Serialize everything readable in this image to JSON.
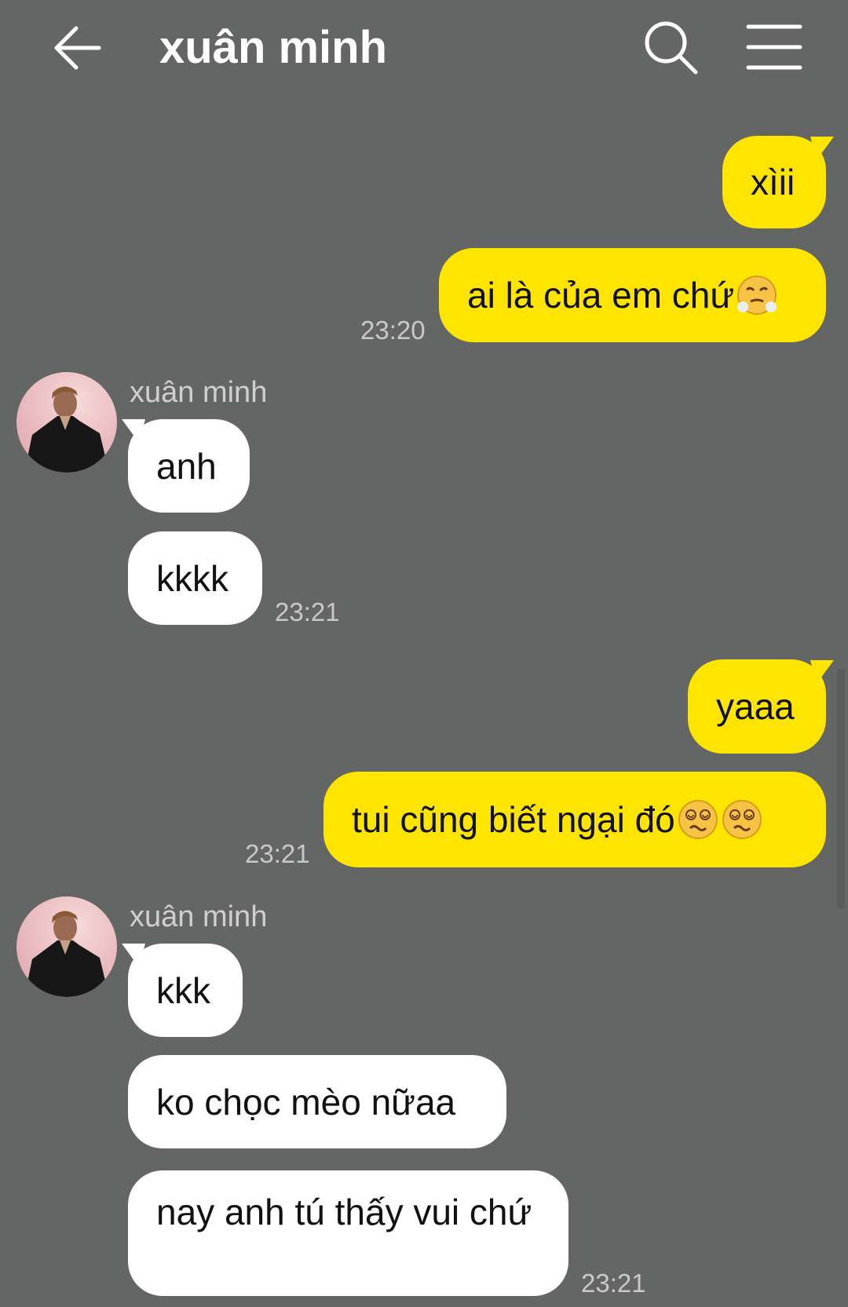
{
  "header": {
    "title": "xuân minh"
  },
  "colors": {
    "background": "#646665",
    "my_bubble": "#fee500",
    "their_bubble": "#ffffff"
  },
  "icons": {
    "back": "arrow-left-icon",
    "search": "search-icon",
    "menu": "hamburger-menu-icon"
  },
  "messages": [
    {
      "sender": "me",
      "text": "xìii"
    },
    {
      "sender": "me",
      "text": "ai là của em chứ",
      "emoji": [
        "huffing-face"
      ],
      "time": "23:20"
    },
    {
      "sender": "them",
      "name": "xuân minh",
      "text": "anh"
    },
    {
      "sender": "them",
      "text": "kkkk",
      "time": "23:21"
    },
    {
      "sender": "me",
      "text": "yaaa"
    },
    {
      "sender": "me",
      "text": "tui cũng biết ngại đó",
      "emoji": [
        "dizzy-face",
        "dizzy-face"
      ],
      "time": "23:21"
    },
    {
      "sender": "them",
      "name": "xuân minh",
      "text": "kkk"
    },
    {
      "sender": "them",
      "text": "ko chọc mèo nữaa"
    },
    {
      "sender": "them",
      "text": "nay anh tú thấy vui chứ",
      "time": "23:21"
    }
  ]
}
